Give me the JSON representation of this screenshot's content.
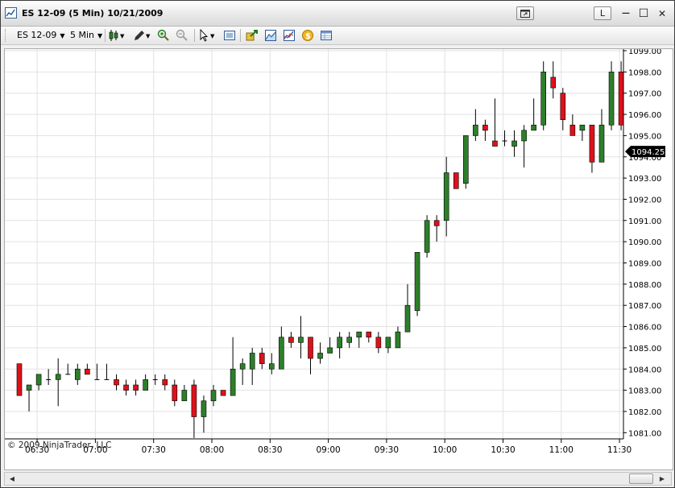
{
  "window": {
    "title": "ES 12-09 (5 Min)  10/21/2009",
    "link_label": "L",
    "minimize_glyph": "—",
    "maximize_glyph": "☐",
    "close_glyph": "✕"
  },
  "toolbar": {
    "instrument": "ES 12-09",
    "interval": "5 Min"
  },
  "chart": {
    "copyright": "© 2009 NinjaTrader, LLC",
    "last_price_label": "1094.25",
    "colors": {
      "up": "#2d7f2a",
      "down": "#e0101a",
      "wick": "#000000",
      "grid": "#e2e2e2",
      "price_tag": "#000000"
    }
  },
  "chart_data": {
    "type": "candlestick",
    "title": "",
    "xlabel": "",
    "ylabel": "",
    "ylim": [
      1080.5,
      1099.25
    ],
    "y_ticks": [
      "1081.00",
      "1082.00",
      "1083.00",
      "1084.00",
      "1085.00",
      "1086.00",
      "1087.00",
      "1088.00",
      "1089.00",
      "1090.00",
      "1091.00",
      "1092.00",
      "1093.00",
      "1094.00",
      "1095.00",
      "1096.00",
      "1097.00",
      "1098.00",
      "1099.00"
    ],
    "x_ticks": [
      "06:30",
      "07:00",
      "07:30",
      "08:00",
      "08:30",
      "09:00",
      "09:30",
      "10:00",
      "10:30",
      "11:00",
      "11:30"
    ],
    "first_bar_time": "06:20",
    "bar_minutes": 5,
    "last_price": 1094.25,
    "grid": true,
    "ohlc": [
      [
        1084.25,
        1084.25,
        1082.75,
        1082.75
      ],
      [
        1083.0,
        1083.25,
        1082.0,
        1083.25
      ],
      [
        1083.25,
        1083.75,
        1083.0,
        1083.75
      ],
      [
        1083.5,
        1084.0,
        1083.25,
        1083.5
      ],
      [
        1083.5,
        1084.5,
        1082.25,
        1083.75
      ],
      [
        1083.75,
        1084.25,
        1083.75,
        1083.75
      ],
      [
        1083.5,
        1084.25,
        1083.25,
        1084.0
      ],
      [
        1084.0,
        1084.25,
        1083.75,
        1083.75
      ],
      [
        1083.5,
        1084.25,
        1083.5,
        1083.5
      ],
      [
        1083.5,
        1084.25,
        1083.5,
        1083.5
      ],
      [
        1083.5,
        1083.75,
        1083.0,
        1083.25
      ],
      [
        1083.25,
        1083.5,
        1082.75,
        1083.0
      ],
      [
        1083.25,
        1083.5,
        1082.75,
        1083.0
      ],
      [
        1083.0,
        1083.75,
        1083.0,
        1083.5
      ],
      [
        1083.5,
        1083.75,
        1083.25,
        1083.5
      ],
      [
        1083.5,
        1083.75,
        1083.0,
        1083.25
      ],
      [
        1083.25,
        1083.5,
        1082.25,
        1082.5
      ],
      [
        1082.5,
        1083.25,
        1082.5,
        1083.0
      ],
      [
        1083.25,
        1083.5,
        1080.75,
        1081.75
      ],
      [
        1081.75,
        1082.75,
        1081.0,
        1082.5
      ],
      [
        1082.5,
        1083.25,
        1082.25,
        1083.0
      ],
      [
        1083.0,
        1083.0,
        1082.75,
        1082.75
      ],
      [
        1082.75,
        1085.5,
        1082.75,
        1084.0
      ],
      [
        1084.0,
        1084.5,
        1083.25,
        1084.25
      ],
      [
        1084.0,
        1085.0,
        1083.25,
        1084.75
      ],
      [
        1084.75,
        1085.0,
        1084.0,
        1084.25
      ],
      [
        1084.0,
        1084.75,
        1083.75,
        1084.25
      ],
      [
        1084.0,
        1086.0,
        1084.0,
        1085.5
      ],
      [
        1085.5,
        1085.75,
        1085.0,
        1085.25
      ],
      [
        1085.25,
        1086.5,
        1084.5,
        1085.5
      ],
      [
        1085.5,
        1085.5,
        1083.75,
        1084.5
      ],
      [
        1084.5,
        1085.25,
        1084.25,
        1084.75
      ],
      [
        1084.75,
        1085.5,
        1084.75,
        1085.0
      ],
      [
        1085.0,
        1085.75,
        1084.5,
        1085.5
      ],
      [
        1085.25,
        1085.75,
        1085.0,
        1085.5
      ],
      [
        1085.5,
        1085.75,
        1085.0,
        1085.75
      ],
      [
        1085.75,
        1085.75,
        1085.25,
        1085.5
      ],
      [
        1085.5,
        1085.75,
        1084.75,
        1085.0
      ],
      [
        1085.0,
        1085.5,
        1084.75,
        1085.5
      ],
      [
        1085.0,
        1086.0,
        1085.0,
        1085.75
      ],
      [
        1085.75,
        1088.0,
        1085.75,
        1087.0
      ],
      [
        1086.75,
        1089.5,
        1086.5,
        1089.5
      ],
      [
        1089.5,
        1091.25,
        1089.25,
        1091.0
      ],
      [
        1091.0,
        1091.25,
        1090.0,
        1090.75
      ],
      [
        1091.0,
        1094.0,
        1090.25,
        1093.25
      ],
      [
        1093.25,
        1093.25,
        1092.5,
        1092.5
      ],
      [
        1092.75,
        1095.0,
        1092.5,
        1095.0
      ],
      [
        1095.0,
        1096.25,
        1094.75,
        1095.5
      ],
      [
        1095.5,
        1095.75,
        1094.75,
        1095.25
      ],
      [
        1094.75,
        1096.75,
        1094.5,
        1094.5
      ],
      [
        1094.75,
        1095.25,
        1094.5,
        1094.75
      ],
      [
        1094.5,
        1095.25,
        1094.0,
        1094.75
      ],
      [
        1094.75,
        1095.5,
        1093.5,
        1095.25
      ],
      [
        1095.25,
        1096.75,
        1095.25,
        1095.5
      ],
      [
        1095.5,
        1098.5,
        1095.25,
        1098.0
      ],
      [
        1097.75,
        1098.5,
        1096.75,
        1097.25
      ],
      [
        1097.0,
        1097.25,
        1095.25,
        1095.75
      ],
      [
        1095.5,
        1096.0,
        1095.0,
        1095.0
      ],
      [
        1095.25,
        1095.5,
        1094.75,
        1095.5
      ],
      [
        1095.5,
        1095.5,
        1093.25,
        1093.75
      ],
      [
        1093.75,
        1096.25,
        1093.75,
        1095.5
      ],
      [
        1095.5,
        1098.5,
        1095.25,
        1098.0
      ],
      [
        1098.0,
        1098.5,
        1095.25,
        1095.5
      ]
    ]
  }
}
